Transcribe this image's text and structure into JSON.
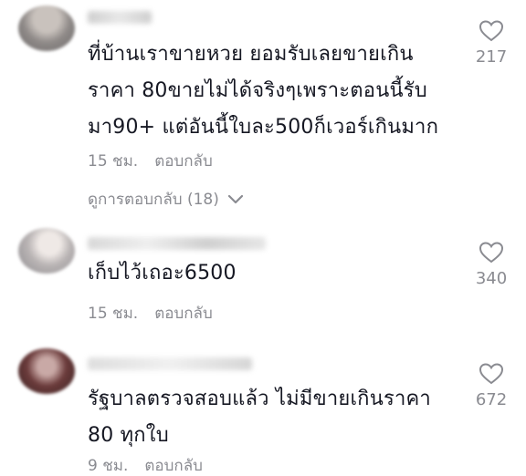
{
  "comments": [
    {
      "text": "ที่บ้านเราขายหวย ยอมรับเลยขายเกิน\nราคา 80ขายไม่ได้จริงๆเพราะตอนนี้รับ\nมา90+ แต่อันนี้ใบละ500ก็เวอร์เกินมาก",
      "time": "15 ชม.",
      "reply_label": "ตอบกลับ",
      "likes": "217",
      "view_replies_label": "ดูการตอบกลับ (18)"
    },
    {
      "text": "เก็บไว้เถอะ6500",
      "time": "15 ชม.",
      "reply_label": "ตอบกลับ",
      "likes": "340"
    },
    {
      "text": "รัฐบาลตรวจสอบแล้ว ไม่มีขายเกินราคา\n80 ทุกใบ",
      "time": "9 ชม.",
      "reply_label": "ตอบกลับ",
      "likes": "672"
    }
  ],
  "icons": {
    "like": "heart-outline-icon",
    "expand": "chevron-down-icon"
  },
  "colors": {
    "text": "#161823",
    "secondary": "#8a8b91"
  }
}
